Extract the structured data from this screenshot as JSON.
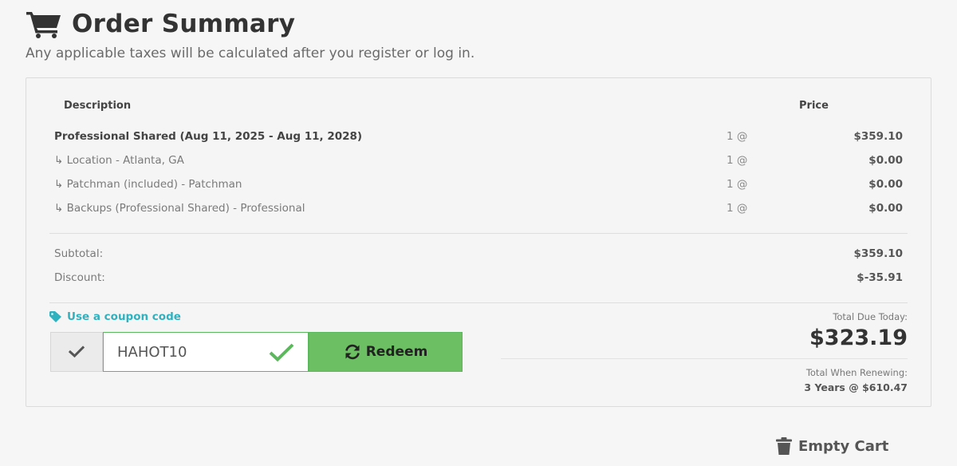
{
  "header": {
    "title": "Order Summary",
    "subtitle": "Any applicable taxes will be calculated after you register or log in."
  },
  "table": {
    "columns": {
      "description": "Description",
      "price": "Price"
    },
    "items": [
      {
        "description": "Professional Shared (Aug 11, 2025 - Aug 11, 2028)",
        "qty": "1 @",
        "price": "$359.10"
      },
      {
        "description": "↳ Location - Atlanta, GA",
        "qty": "1 @",
        "price": "$0.00"
      },
      {
        "description": "↳ Patchman (included) - Patchman",
        "qty": "1 @",
        "price": "$0.00"
      },
      {
        "description": "↳ Backups (Professional Shared) - Professional",
        "qty": "1 @",
        "price": "$0.00"
      }
    ]
  },
  "totals": {
    "subtotal_label": "Subtotal:",
    "subtotal_value": "$359.10",
    "discount_label": "Discount:",
    "discount_value": "$-35.91",
    "due_label": "Total Due Today:",
    "due_value": "$323.19",
    "renew_label": "Total When Renewing:",
    "renew_value": "3 Years @ $610.47"
  },
  "coupon": {
    "link_label": "Use a coupon code",
    "code": "HAHOT10",
    "redeem_label": "Redeem"
  },
  "actions": {
    "empty_cart_label": "Empty Cart"
  },
  "colors": {
    "accent": "#2fb2c0",
    "success": "#5cb85c",
    "redeem_bg": "#6cbf63"
  }
}
